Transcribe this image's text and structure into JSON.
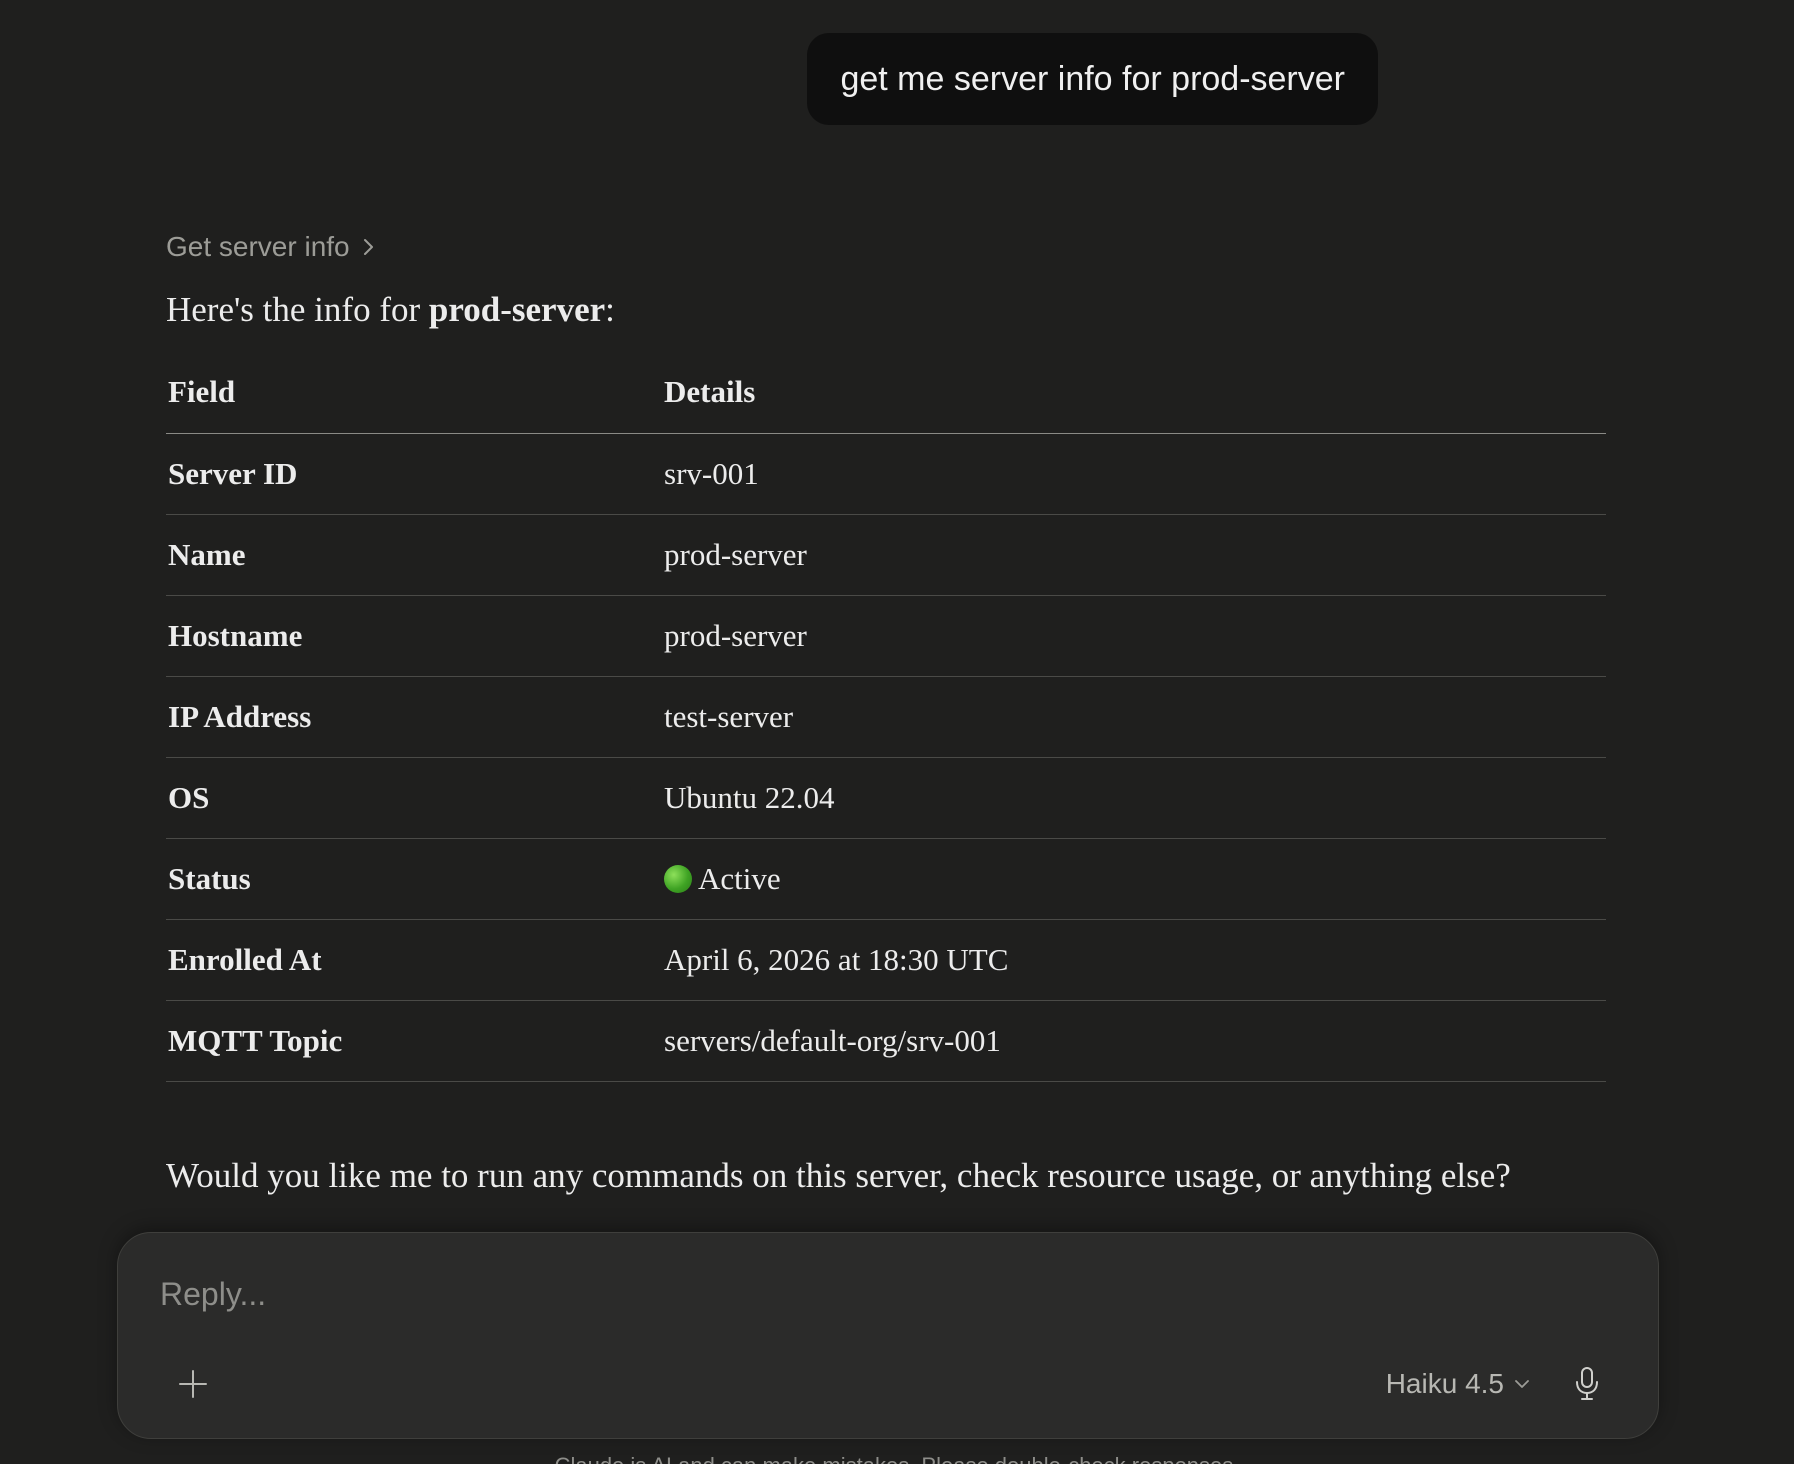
{
  "user_message": {
    "text": "get me server info for prod-server"
  },
  "assistant": {
    "tool_call_label": "Get server info",
    "intro_prefix": "Here's the info for ",
    "intro_server": "prod-server",
    "intro_suffix": ":",
    "table": {
      "headers": [
        "Field",
        "Details"
      ],
      "rows": [
        {
          "field": "Server ID",
          "value": "srv-001"
        },
        {
          "field": "Name",
          "value": "prod-server"
        },
        {
          "field": "Hostname",
          "value": "prod-server"
        },
        {
          "field": "IP Address",
          "value": "test-server"
        },
        {
          "field": "OS",
          "value": "Ubuntu 22.04"
        },
        {
          "field": "Status",
          "value": "Active",
          "status_color": "#3fa324"
        },
        {
          "field": "Enrolled At",
          "value": "April 6, 2026 at 18:30 UTC"
        },
        {
          "field": "MQTT Topic",
          "value": "servers/default-org/srv-001"
        }
      ]
    },
    "followup": "Would you like me to run any commands on this server, check resource usage, or anything else?"
  },
  "composer": {
    "placeholder": "Reply...",
    "model": "Haiku 4.5",
    "icons": {
      "add": "plus-icon",
      "model_dropdown": "chevron-down-icon",
      "voice": "microphone-icon"
    }
  },
  "footer": {
    "disclaimer": "Claude is AI and can make mistakes. Please double-check responses."
  }
}
